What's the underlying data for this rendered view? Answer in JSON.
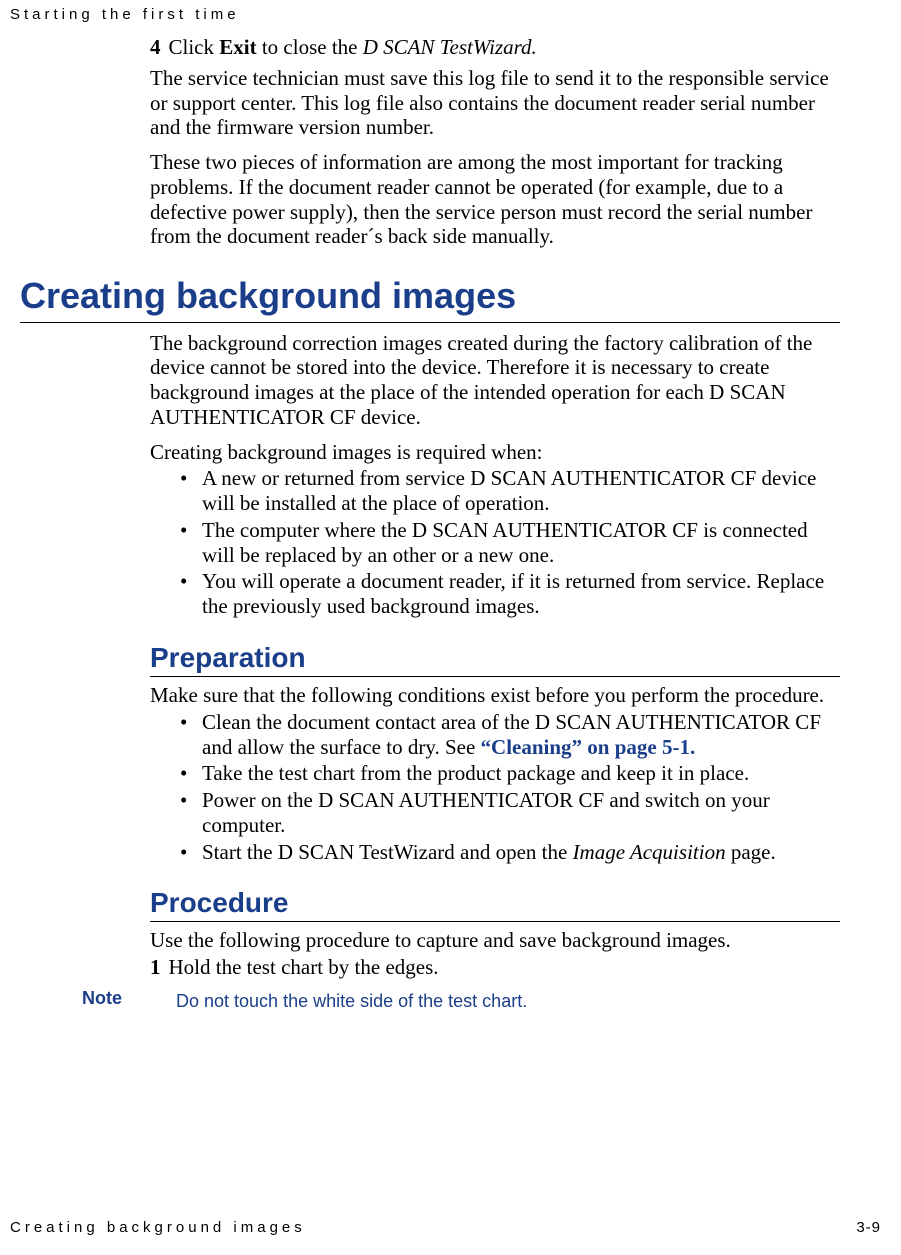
{
  "runningHeader": "Starting the first time",
  "step4": {
    "num": "4",
    "pre": "Click ",
    "bold": "Exit",
    "mid": " to close the ",
    "ital": "D SCAN TestWizard.",
    "post": ""
  },
  "para1": "The service technician must save this log file to send it to the responsible service or support center. This log file also contains the document reader serial number and the firmware version number.",
  "para2": "These two pieces of information are among the most important for tracking problems. If the document reader cannot be operated (for example, due to a defective power supply), then the service person must record the serial number from the document reader´s back side manually.",
  "h1": "Creating background images",
  "sec1_para": "The background correction images created during the factory calibration of the device cannot be stored into the device. Therefore it is necessary to create background images at the place of the intended operation for each D SCAN AUTHENTICATOR CF device.",
  "sec1_intro": "Creating background images is required when:",
  "sec1_items": [
    "A new or returned from service D SCAN AUTHENTICATOR CF device will be installed at the place of operation.",
    "The computer where the D SCAN AUTHENTICATOR CF is connected will be replaced by an other or a new one.",
    "You will operate a document reader, if it is returned from service. Replace the previously used background images."
  ],
  "h2a": "Preparation",
  "prep_intro": "Make sure that the following conditions exist before you perform the procedure.",
  "prep_item1_pre": "Clean the document contact area of the D SCAN AUTHENTICATOR CF and allow the surface to dry. See ",
  "prep_item1_link": "“Cleaning” on page 5-1.",
  "prep_items_rest": [
    "Take the test chart from the product package and keep it in place.",
    "Power on the D SCAN AUTHENTICATOR CF and switch on your computer."
  ],
  "prep_item_last_pre": "Start the D SCAN TestWizard and open the ",
  "prep_item_last_ital": "Image Acquisition",
  "prep_item_last_post": " page.",
  "h2b": "Procedure",
  "proc_intro": "Use the following procedure to capture and save background images.",
  "proc_step1": {
    "num": "1",
    "text": "Hold the test chart by the edges."
  },
  "note_label": "Note",
  "note_text": "Do not touch the white side of the test chart.",
  "footer_left": "Creating background images",
  "footer_page": "3-9"
}
